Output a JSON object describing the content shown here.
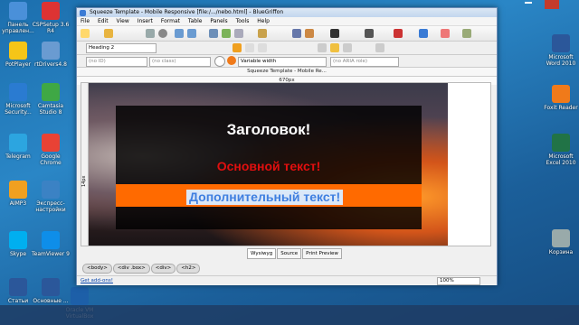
{
  "desktop": {
    "icons_left": [
      {
        "label": "Панель управлен...",
        "color": "#4a90d9"
      },
      {
        "label": "CSPSetup 3.6 R4",
        "color": "#d33"
      },
      {
        "label": "PotPlayer",
        "color": "#f5c518"
      },
      {
        "label": "rtDrivers4.8",
        "color": "#6a9bd1"
      },
      {
        "label": "Microsoft Security...",
        "color": "#2a7bd1"
      },
      {
        "label": "Camtasia Studio 8",
        "color": "#3fa845"
      },
      {
        "label": "Telegram",
        "color": "#2ca5e0"
      },
      {
        "label": "Google Chrome",
        "color": "#e94235"
      },
      {
        "label": "AIMP3",
        "color": "#f0a020"
      },
      {
        "label": "Экспресс-настройки",
        "color": "#3b82c4"
      },
      {
        "label": "Skype",
        "color": "#00aff0"
      },
      {
        "label": "TeamViewer 9",
        "color": "#0e8ee9"
      },
      {
        "label": "Статьи",
        "color": "#2b579a"
      },
      {
        "label": "Основные ...",
        "color": "#2b579a"
      },
      {
        "label": "Oracle VM VirtualBox",
        "color": "#1d5fa8"
      }
    ],
    "icons_right": [
      {
        "label": "Microsoft Word 2010",
        "color": "#2b579a"
      },
      {
        "label": "Foxit Reader",
        "color": "#f07a1a"
      },
      {
        "label": "Microsoft Excel 2010",
        "color": "#217346"
      },
      {
        "label": "Корзина",
        "color": "#9aa"
      }
    ]
  },
  "window": {
    "title": "Squeeze Template - Mobile Responsive [file:/.../nebo.html] - BlueGriffon",
    "menu": [
      "File",
      "Edit",
      "View",
      "Insert",
      "Format",
      "Table",
      "Panels",
      "Tools",
      "Help"
    ],
    "format_select": "Heading 2",
    "id_select": "(no ID)",
    "class_select": "(no class)",
    "width_select": "Variable width",
    "aria_select": "(no ARIA role)",
    "document_tab": "Squeeze Template - Mobile Re...",
    "ruler_label": "670px",
    "vruler_label": "14px",
    "content": {
      "heading": "Заголовок!",
      "main_text": "Основной текст!",
      "extra_text": "Дополнительный текст!"
    },
    "view_tabs": [
      "Wysiwyg",
      "Source",
      "Print Preview"
    ],
    "breadcrumbs": [
      "<body>",
      "<div .box>",
      "<div>",
      "<h2>"
    ],
    "status_link": "Get add-ons!",
    "zoom": "100%"
  }
}
